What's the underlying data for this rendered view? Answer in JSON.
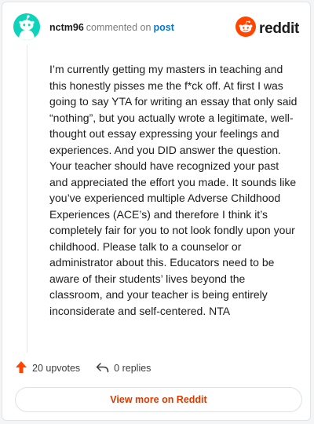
{
  "comment": {
    "username": "nctm96",
    "action_text": "commented on",
    "post_link": "post",
    "body": "I’m currently getting my masters in teaching and this honestly pisses me the f*ck off. At first I was going to say YTA for writing an essay that only said “nothing”, but you actually wrote a legitimate, well-thought out essay expressing your feelings and experiences. And you DID answer the question. Your teacher should have recognized your past and appreciated the effort you made. It sounds like you’ve experienced multiple Adverse Childhood Experiences (ACE’s) and therefore I think it’s completely fair for you to not look fondly upon your childhood. Please talk to a counselor or administrator about this. Educators need to be aware of their students’ lives beyond the classroom, and your teacher is being entirely inconsiderate and self-centered. NTA"
  },
  "brand": {
    "name": "reddit",
    "logo_icon": "reddit-logo-icon",
    "color": "#ff4500"
  },
  "actions": {
    "upvotes": "20 upvotes",
    "upvote_icon": "upvote-arrow-icon",
    "upvote_color": "#ff4500",
    "replies": "0 replies",
    "reply_icon": "reply-arrow-icon"
  },
  "footer": {
    "view_more": "View more on Reddit",
    "color": "#d93a00"
  },
  "avatar": {
    "icon": "snoo-avatar-icon",
    "background": "#0dd3bb"
  }
}
